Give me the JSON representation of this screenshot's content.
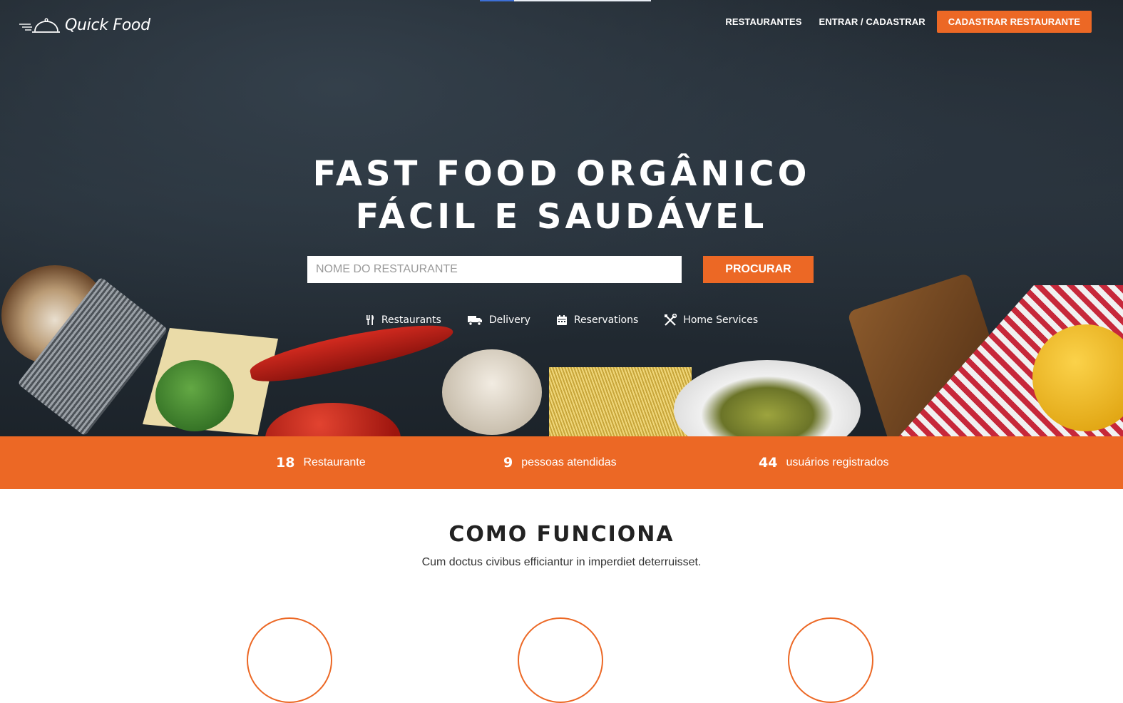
{
  "header": {
    "brand": "Quick Food",
    "top_progress_percent": 20,
    "nav": {
      "restaurants": "RESTAURANTES",
      "login": "ENTRAR / CADASTRAR",
      "register_restaurant": "CADASTRAR RESTAURANTE"
    }
  },
  "hero": {
    "headline_line1": "FAST FOOD ORGÂNICO",
    "headline_line2": "FÁCIL E SAUDÁVEL",
    "search": {
      "placeholder": "NOME DO RESTAURANTE",
      "value": "",
      "button": "PROCURAR"
    },
    "services": [
      {
        "icon": "utensils-icon",
        "label": "Restaurants"
      },
      {
        "icon": "truck-icon",
        "label": "Delivery"
      },
      {
        "icon": "calendar-icon",
        "label": "Reservations"
      },
      {
        "icon": "tools-icon",
        "label": "Home Services"
      }
    ]
  },
  "stats": [
    {
      "number": "18",
      "label": "Restaurante"
    },
    {
      "number": "9",
      "label": "pessoas atendidas"
    },
    {
      "number": "44",
      "label": "usuários registrados"
    }
  ],
  "how": {
    "title": "COMO FUNCIONA",
    "subtitle": "Cum doctus civibus efficiantur in imperdiet deterruisset."
  },
  "colors": {
    "accent": "#ec6825",
    "hero_bg": "#222a32",
    "progress": "#3d6fd6"
  }
}
